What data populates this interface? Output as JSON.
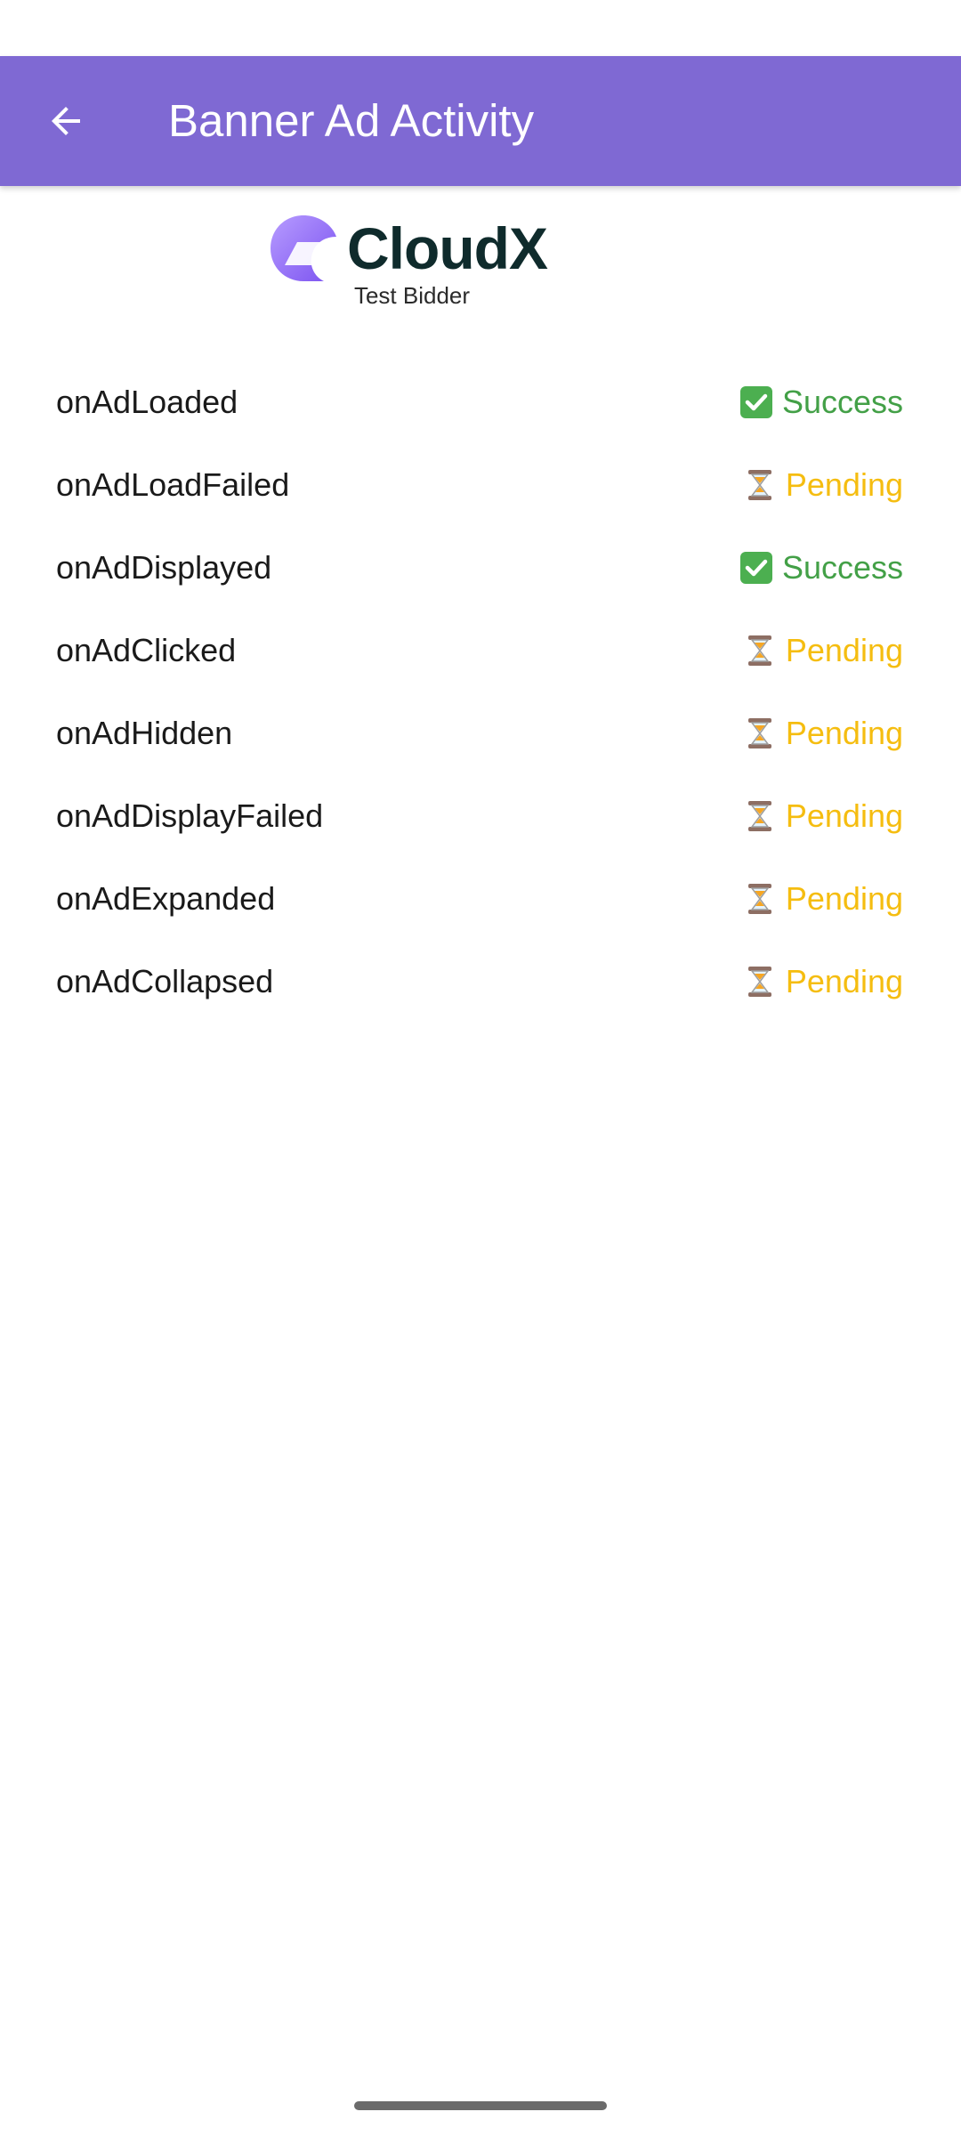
{
  "app_bar": {
    "title": "Banner Ad Activity",
    "back_icon": "arrow-left-icon",
    "color": "#7f69d3"
  },
  "logo": {
    "name": "CloudX",
    "subtitle": "Test Bidder"
  },
  "status_colors": {
    "success": "#43a047",
    "pending": "#f5bd10"
  },
  "events": [
    {
      "name": "onAdLoaded",
      "status": "Success",
      "icon": "check-mark-icon"
    },
    {
      "name": "onAdLoadFailed",
      "status": "Pending",
      "icon": "hourglass-icon"
    },
    {
      "name": "onAdDisplayed",
      "status": "Success",
      "icon": "check-mark-icon"
    },
    {
      "name": "onAdClicked",
      "status": "Pending",
      "icon": "hourglass-icon"
    },
    {
      "name": "onAdHidden",
      "status": "Pending",
      "icon": "hourglass-icon"
    },
    {
      "name": "onAdDisplayFailed",
      "status": "Pending",
      "icon": "hourglass-icon"
    },
    {
      "name": "onAdExpanded",
      "status": "Pending",
      "icon": "hourglass-icon"
    },
    {
      "name": "onAdCollapsed",
      "status": "Pending",
      "icon": "hourglass-icon"
    }
  ]
}
